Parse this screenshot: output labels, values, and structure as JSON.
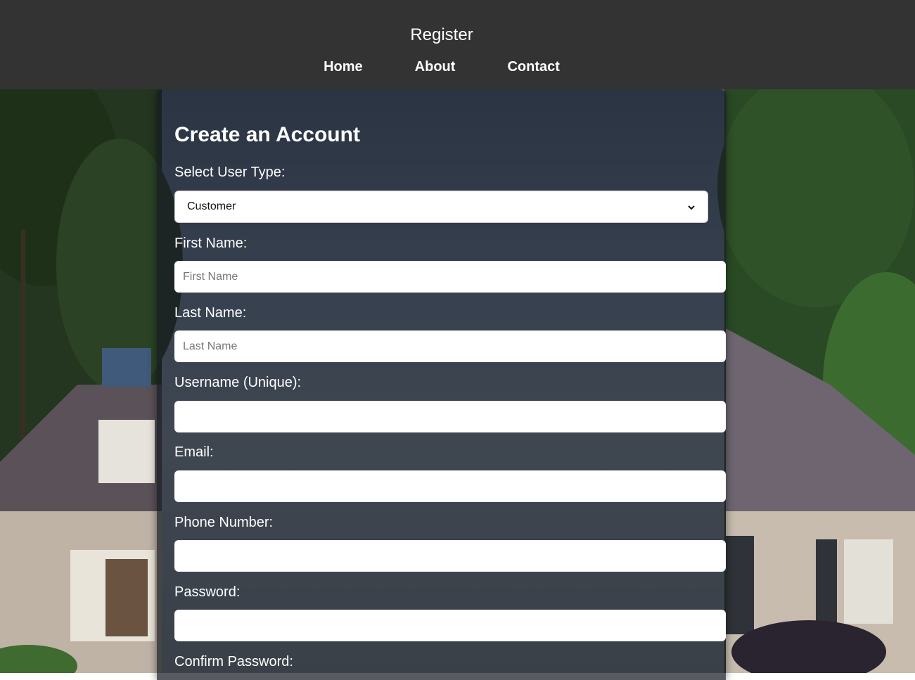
{
  "header": {
    "title": "Register",
    "nav": [
      {
        "label": "Home"
      },
      {
        "label": "About"
      },
      {
        "label": "Contact"
      }
    ]
  },
  "form": {
    "heading": "Create an Account",
    "user_type": {
      "label": "Select User Type:",
      "selected": "Customer"
    },
    "first_name": {
      "label": "First Name:",
      "placeholder": "First Name",
      "value": ""
    },
    "last_name": {
      "label": "Last Name:",
      "placeholder": "Last Name",
      "value": ""
    },
    "username": {
      "label": "Username (Unique):",
      "placeholder": "",
      "value": ""
    },
    "email": {
      "label": "Email:",
      "placeholder": "",
      "value": ""
    },
    "phone": {
      "label": "Phone Number:",
      "placeholder": "",
      "value": ""
    },
    "password": {
      "label": "Password:",
      "placeholder": "",
      "value": ""
    },
    "confirm_password": {
      "label": "Confirm Password:"
    }
  },
  "icons": {
    "select_arrow": "chevron-down-icon"
  },
  "colors": {
    "header_bg": "#333333",
    "card_overlay": "#161a22",
    "text": "#ffffff"
  }
}
